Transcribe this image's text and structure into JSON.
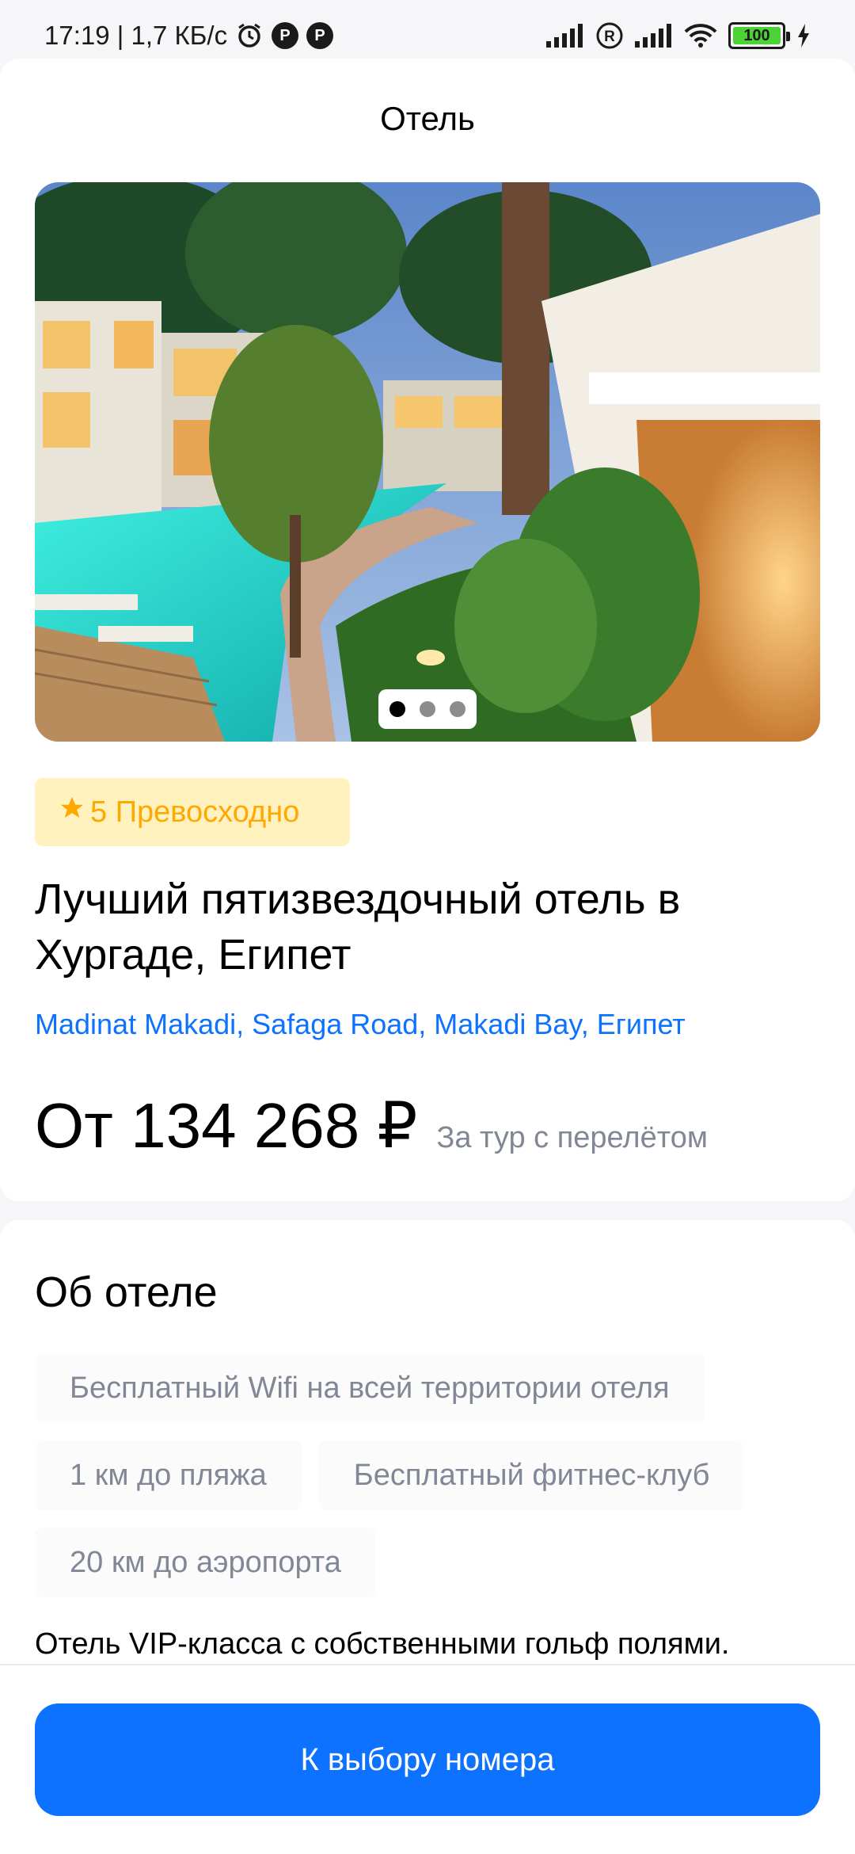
{
  "status_bar": {
    "time_and_speed": "17:19 | 1,7 КБ/с",
    "battery_level": "100"
  },
  "header": {
    "title": "Отель"
  },
  "gallery": {
    "slides_total": 3,
    "active_slide": 1
  },
  "hotel": {
    "rating_text": "5 Превосходно",
    "name": "Лучший пятизвездочный отель в Хургаде, Египет",
    "address": "Madinat Makadi, Safaga Road, Makadi Bay, Египет",
    "price": "От 134 268 ₽",
    "price_note": "За тур с перелётом"
  },
  "about": {
    "title": "Об отеле",
    "tags": [
      "Бесплатный Wifi на всей территории отеля",
      "1 км до пляжа",
      "Бесплатный фитнес-клуб",
      "20 км до аэропорта"
    ],
    "description": "Отель VIP-класса с собственными гольф полями."
  },
  "footer": {
    "button_label": "К выбору номера"
  },
  "colors": {
    "accent": "#0D72FF",
    "rating_bg": "#FFF2BF",
    "rating_text": "#FFA800",
    "muted_text": "#828796"
  }
}
